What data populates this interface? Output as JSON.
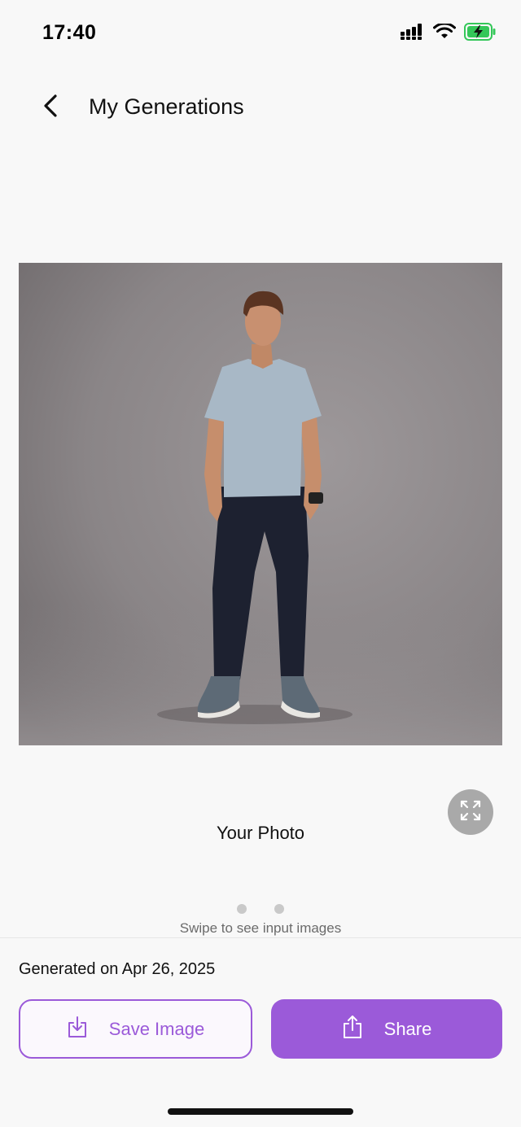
{
  "status_bar": {
    "time": "17:40",
    "icons": [
      "cellular-signal-icon",
      "wifi-icon",
      "battery-charging-icon"
    ]
  },
  "header": {
    "back_icon": "chevron-left-icon",
    "title": "My Generations"
  },
  "photo": {
    "subject": "generated-photo-man-standing",
    "expand_icon": "expand-arrows-icon"
  },
  "caption": "Your Photo",
  "pagination": {
    "count": 2
  },
  "swipe_hint": "Swipe to see input images",
  "generated_label": "Generated on Apr 26, 2025",
  "actions": {
    "save_label": "Save Image",
    "save_icon": "download-icon",
    "share_label": "Share",
    "share_icon": "share-icon"
  },
  "colors": {
    "accent": "#9b5ad9",
    "background": "#f8f8f8",
    "battery": "#34c759"
  }
}
